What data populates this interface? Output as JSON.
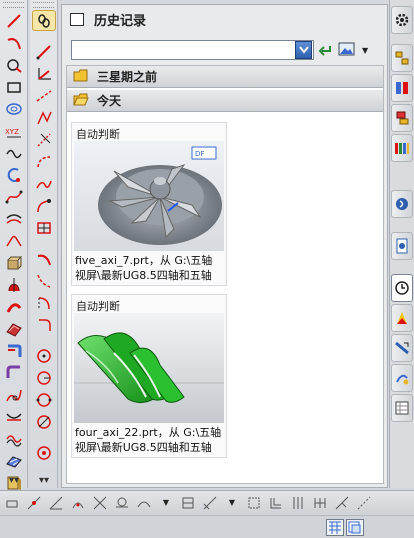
{
  "panel": {
    "title": "历史记录",
    "search": {
      "value": "",
      "placeholder": ""
    }
  },
  "groups": [
    {
      "label": "三星期之前"
    },
    {
      "label": "今天"
    }
  ],
  "items": [
    {
      "caption": "自动判断",
      "name": "five_axi_7.prt，从 G:\\五轴视屏\\最新UG8.5四轴和五轴"
    },
    {
      "caption": "自动判断",
      "name": "four_axi_22.prt，从 G:\\五轴视屏\\最新UG8.5四轴和五轴"
    }
  ],
  "icons": {
    "left_toolbar_1": [
      "line-icon",
      "arc-icon",
      "circle-icon",
      "rectangle-icon",
      "spiral-icon",
      "point-set-icon",
      "curve-icon",
      "helix-icon",
      "spline-icon",
      "offset-curve-icon",
      "bridge-curve-icon",
      "extrude-icon",
      "revolve-icon",
      "sweep-icon",
      "face-icon",
      "blend-icon",
      "trim-icon",
      "project-icon",
      "combine-icon",
      "section-icon",
      "mesh-icon",
      "shade-icon"
    ],
    "left_toolbar_2": [
      "chain-icon",
      "line-ortho-icon",
      "axis-icon",
      "xy-line-icon",
      "polyline-icon",
      "polygon-icon",
      "arc-3pt-icon",
      "curve-fit-icon",
      "box-icon",
      "corner-arc-icon",
      "fillet-arc-icon",
      "angle-arc-icon",
      "join-arc-icon",
      "circle-fill-icon",
      "circle-tangent-icon",
      "circle-center-icon",
      "circle-3pt-icon",
      "circle-offset-icon"
    ],
    "right_dock": [
      "settings-icon",
      "assembly-navigator-icon",
      "constraint-navigator-icon",
      "part-navigator-icon",
      "reuse-library-icon",
      "hd3d-icon",
      "web-browser-icon",
      "history-icon",
      "system-materials-icon",
      "process-studio-icon",
      "roles-icon",
      "system-scenes-icon"
    ]
  },
  "colors": {
    "accent": "#2d5fae",
    "selected": "#f6e7a8",
    "folder": "#e8b428"
  }
}
